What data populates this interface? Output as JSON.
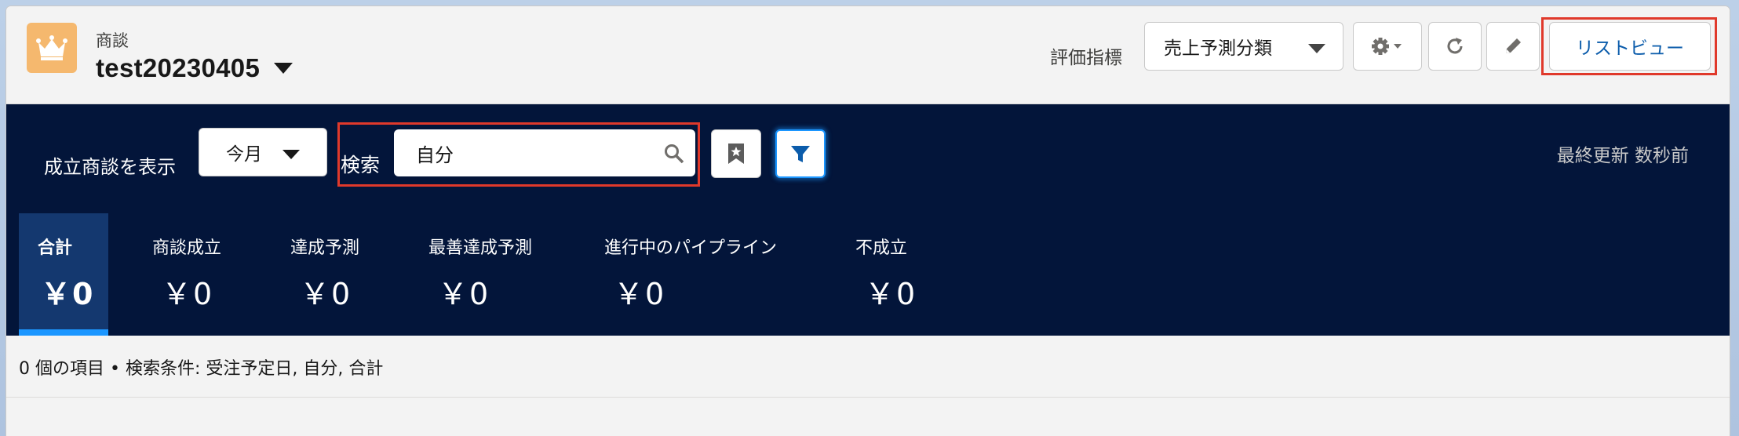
{
  "header": {
    "object_label": "商談",
    "record_title": "test20230405",
    "metric_label": "評価指標",
    "metric_value": "売上予測分類",
    "list_view_label": "リストビュー",
    "icons": [
      "crown-icon",
      "gear-icon",
      "refresh-icon",
      "pencil-icon"
    ]
  },
  "filters": {
    "show_won_label": "成立商談を表示",
    "period_value": "今月",
    "search_label": "検索",
    "search_value": "自分",
    "last_updated": "最終更新 数秒前"
  },
  "summary": [
    {
      "label": "合計",
      "value": "￥0",
      "selected": true
    },
    {
      "label": "商談成立",
      "value": "￥0"
    },
    {
      "label": "達成予測",
      "value": "￥0"
    },
    {
      "label": "最善達成予測",
      "value": "￥0"
    },
    {
      "label": "進行中のパイプライン",
      "value": "￥0"
    },
    {
      "label": "不成立",
      "value": "￥0"
    }
  ],
  "status_text": "0 個の項目 • 検索条件: 受注予定日, 自分, 合計",
  "colors": {
    "panel_bg": "#03153a",
    "accent": "#1b96ff",
    "highlight": "#e0392b",
    "app_icon": "#f5b86e"
  }
}
